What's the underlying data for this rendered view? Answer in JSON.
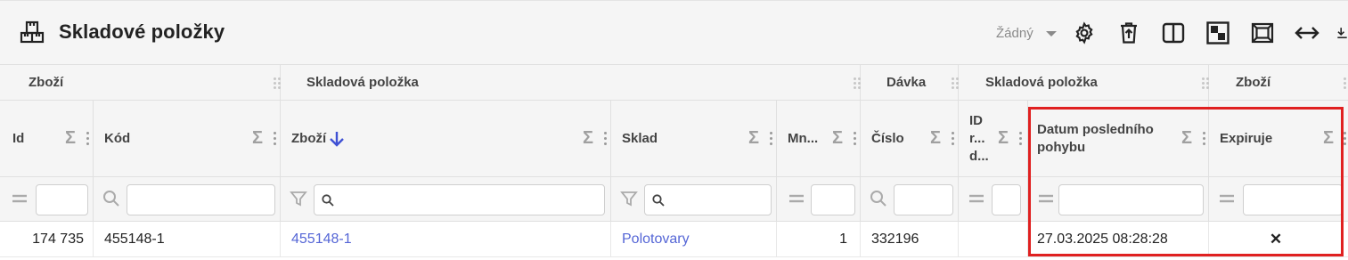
{
  "toolbar": {
    "title": "Skladové položky",
    "preset_value": "Žádný",
    "icons": [
      "warehouse-icon",
      "gear-icon",
      "delete-icon",
      "columns-icon",
      "pivot-icon",
      "fit-screen-icon",
      "expand-horizontal-icon",
      "export-icon"
    ]
  },
  "grid": {
    "groups": [
      "Zboží",
      "Skladová položka",
      "Dávka",
      "Skladová položka",
      "Zboží"
    ],
    "columns": [
      "Id",
      "Kód",
      "Zboží",
      "Sklad",
      "Mn...",
      "Číslo",
      "ID r... d...",
      "Datum posledního pohybu",
      "Expiruje"
    ],
    "sort_column": "Zboží",
    "rows": [
      {
        "id": "174 735",
        "kod": "455148-1",
        "zbozi": "455148-1",
        "sklad": "Polotovary",
        "mnozstvi": "1",
        "cislo": "332196",
        "id_rd": "",
        "datum": "27.03.2025 08:28:28",
        "expiruje": "✕"
      }
    ]
  },
  "colors": {
    "link": "#5566d6",
    "sort_arrow": "#3f51d4",
    "highlight": "#e02020",
    "header_bg": "#f5f5f5"
  }
}
